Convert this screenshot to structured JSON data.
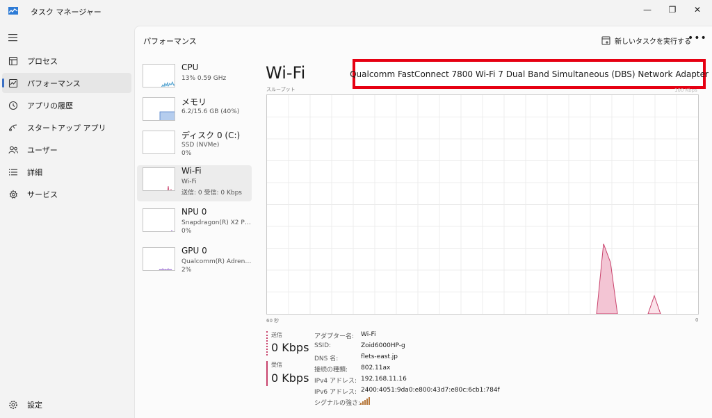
{
  "window": {
    "title": "タスク マネージャー",
    "controls": {
      "minimize": "—",
      "maximize": "❐",
      "close": "✕"
    }
  },
  "nav": {
    "items": [
      {
        "label": "プロセス",
        "icon": "processes-icon"
      },
      {
        "label": "パフォーマンス",
        "icon": "performance-icon",
        "selected": true
      },
      {
        "label": "アプリの履歴",
        "icon": "history-icon"
      },
      {
        "label": "スタートアップ アプリ",
        "icon": "startup-icon"
      },
      {
        "label": "ユーザー",
        "icon": "users-icon"
      },
      {
        "label": "詳細",
        "icon": "details-icon"
      },
      {
        "label": "サービス",
        "icon": "services-icon"
      }
    ],
    "settings": "設定"
  },
  "header": {
    "title": "パフォーマンス",
    "run_task": "新しいタスクを実行する",
    "more": "•••"
  },
  "devices": [
    {
      "name": "CPU",
      "sub1": "13%  0.59 GHz",
      "sub2": ""
    },
    {
      "name": "メモリ",
      "sub1": "6.2/15.6 GB (40%)",
      "sub2": ""
    },
    {
      "name": "ディスク 0 (C:)",
      "sub1": "SSD (NVMe)",
      "sub2": "0%"
    },
    {
      "name": "Wi-Fi",
      "sub1": "Wi-Fi",
      "sub2": "送信: 0  受信: 0 Kbps"
    },
    {
      "name": "NPU 0",
      "sub1": "Snapdragon(R) X2 Plu...",
      "sub2": "0%"
    },
    {
      "name": "GPU 0",
      "sub1": "Qualcomm(R) Adreno...",
      "sub2": "2%"
    }
  ],
  "detail": {
    "title": "Wi-Fi",
    "adapter": "Qualcomm FastConnect 7800 Wi-Fi 7 Dual Band Simultaneous (DBS) Network Adapter",
    "throughput_label": "スループット",
    "max_label": "100 Kbps",
    "time_left": "60 秒",
    "time_right": "0",
    "send_label": "送信",
    "send_value": "0 Kbps",
    "recv_label": "受信",
    "recv_value": "0 Kbps",
    "props": [
      {
        "k": "アダプター名:",
        "v": "Wi-Fi"
      },
      {
        "k": "SSID:",
        "v": "Zoid6000HP-g"
      },
      {
        "k": "DNS 名:",
        "v": "flets-east.jp"
      },
      {
        "k": "接続の種類:",
        "v": "802.11ax"
      },
      {
        "k": "IPv4 アドレス:",
        "v": "192.168.11.16"
      },
      {
        "k": "IPv6 アドレス:",
        "v": "2400:4051:9da0:e800:43d7:e80c:6cb1:784f"
      },
      {
        "k": "シグナルの強さ:",
        "v": ""
      }
    ]
  },
  "colors": {
    "accent": "#3a6fc4",
    "wifi": "#c8416b",
    "highlight": "#e60012"
  }
}
